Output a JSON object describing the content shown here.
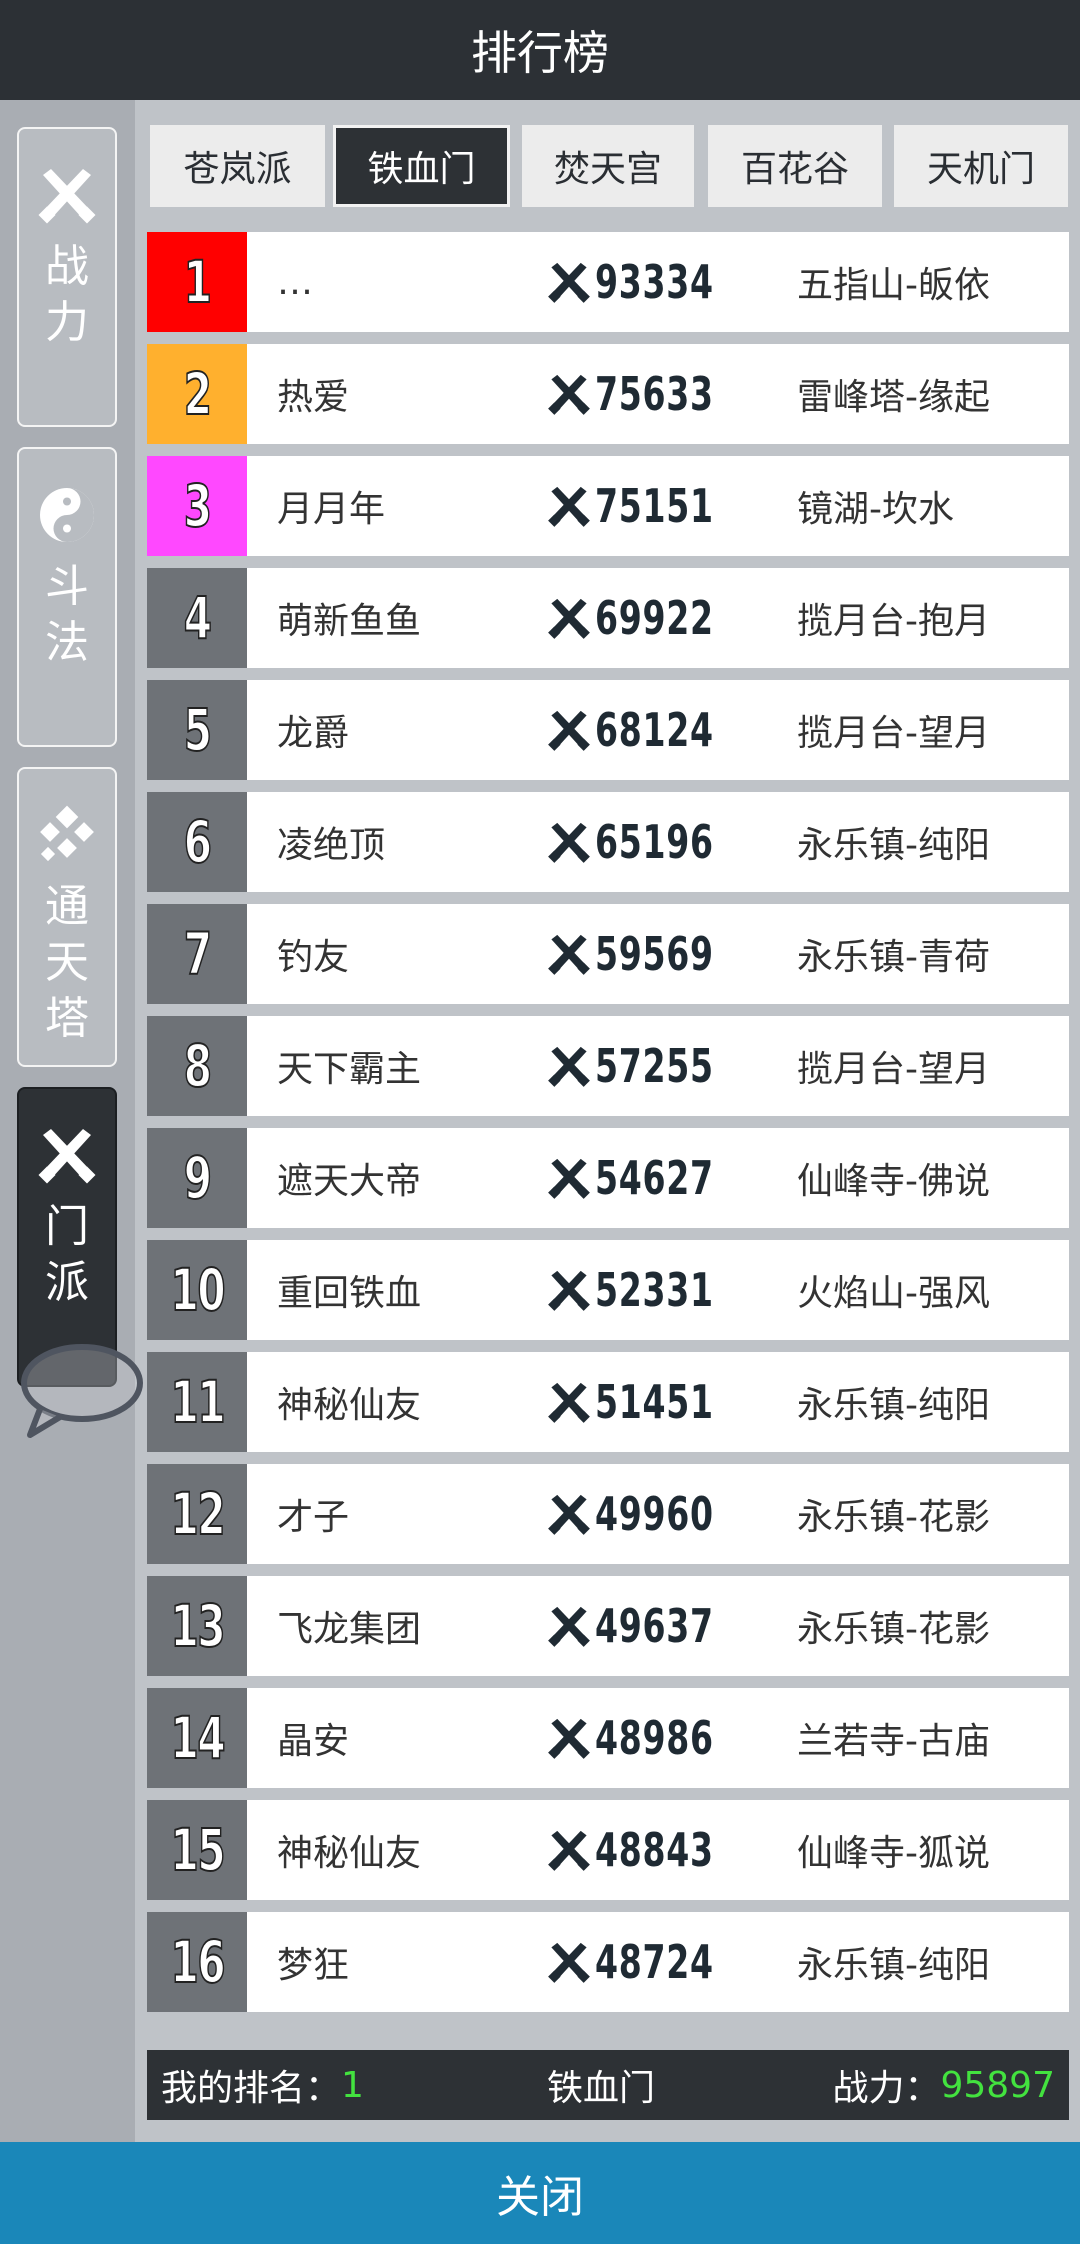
{
  "header": {
    "title": "排行榜"
  },
  "side_tabs": [
    {
      "label": "战力",
      "icon": "crossed-swords-icon",
      "active": false
    },
    {
      "label": "斗法",
      "icon": "yin-yang-icon",
      "active": false
    },
    {
      "label": "通天塔",
      "icon": "diamond-cluster-icon",
      "active": false
    },
    {
      "label": "门派",
      "icon": "crossed-swords-icon",
      "active": true
    }
  ],
  "sect_tabs": [
    {
      "label": "苍岚派",
      "active": false
    },
    {
      "label": "铁血门",
      "active": true
    },
    {
      "label": "焚天宫",
      "active": false
    },
    {
      "label": "百花谷",
      "active": false
    },
    {
      "label": "天机门",
      "active": false
    }
  ],
  "colors": {
    "rank1": "#ff0000",
    "rank2": "#ffb02e",
    "rank3": "#ff48ff",
    "rank_default": "#6e7277",
    "accent_green": "#43e23f",
    "close_blue": "#1a87b9"
  },
  "rows": [
    {
      "rank": "1",
      "name": "…",
      "power": "93334",
      "location": "五指山-皈依"
    },
    {
      "rank": "2",
      "name": "热爱",
      "power": "75633",
      "location": "雷峰塔-缘起"
    },
    {
      "rank": "3",
      "name": "月月年",
      "power": "75151",
      "location": "镜湖-坎水"
    },
    {
      "rank": "4",
      "name": "萌新鱼鱼",
      "power": "69922",
      "location": "揽月台-抱月"
    },
    {
      "rank": "5",
      "name": "龙爵",
      "power": "68124",
      "location": "揽月台-望月"
    },
    {
      "rank": "6",
      "name": "凌绝顶",
      "power": "65196",
      "location": "永乐镇-纯阳"
    },
    {
      "rank": "7",
      "name": "钓友",
      "power": "59569",
      "location": "永乐镇-青荷"
    },
    {
      "rank": "8",
      "name": "天下霸主",
      "power": "57255",
      "location": "揽月台-望月"
    },
    {
      "rank": "9",
      "name": "遮天大帝",
      "power": "54627",
      "location": "仙峰寺-佛说"
    },
    {
      "rank": "10",
      "name": "重回铁血",
      "power": "52331",
      "location": "火焰山-强风"
    },
    {
      "rank": "11",
      "name": "神秘仙友",
      "power": "51451",
      "location": "永乐镇-纯阳"
    },
    {
      "rank": "12",
      "name": "才子",
      "power": "49960",
      "location": "永乐镇-花影"
    },
    {
      "rank": "13",
      "name": "飞龙集团",
      "power": "49637",
      "location": "永乐镇-花影"
    },
    {
      "rank": "14",
      "name": "晶安",
      "power": "48986",
      "location": "兰若寺-古庙"
    },
    {
      "rank": "15",
      "name": "神秘仙友",
      "power": "48843",
      "location": "仙峰寺-狐说"
    },
    {
      "rank": "16",
      "name": "梦狂",
      "power": "48724",
      "location": "永乐镇-纯阳"
    }
  ],
  "footer": {
    "my_rank_label": "我的排名：",
    "my_rank_value": "1",
    "sect_name": "铁血门",
    "power_label": "战力：",
    "power_value": "95897"
  },
  "close_button": {
    "label": "关闭"
  }
}
